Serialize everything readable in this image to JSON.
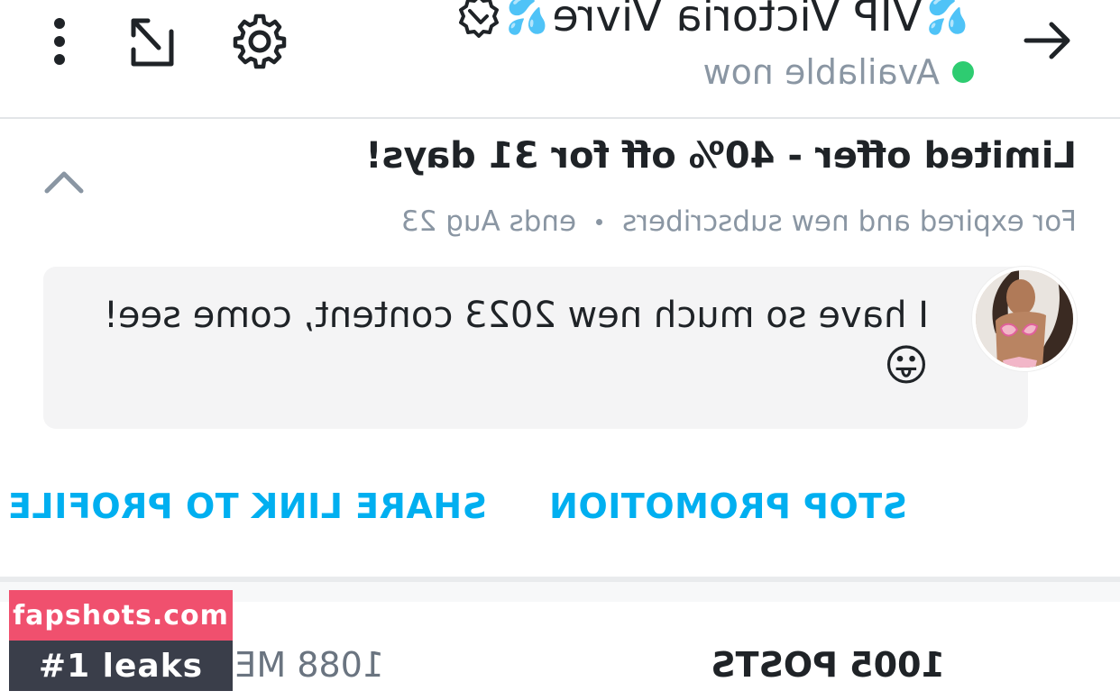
{
  "header": {
    "title": "VIP Victoria Vivre",
    "title_emoji_left": "💦",
    "title_emoji_right": "💦",
    "status_text": "Available now",
    "status_color": "#2ecc71",
    "icons": [
      "back-arrow-icon",
      "verified-badge-icon",
      "settings-gear-icon",
      "share-icon",
      "more-vertical-icon"
    ]
  },
  "promotion": {
    "title": "Limited offer - 40% off for 31 days!",
    "audience": "For expired and new subscribers",
    "ends": "ends Aug 23",
    "message": "I have so much new 2023 content, come see!",
    "message_emoji": "😛",
    "share_label": "SHARE LINK TO PROFILE",
    "stop_label": "STOP PROMOTION",
    "accent_color": "#00aff0"
  },
  "stats": {
    "posts": "1005 POSTS",
    "media": "1088 MEDIA"
  },
  "watermark": {
    "line1": "fapshots.com",
    "line2": "#1 leaks"
  }
}
